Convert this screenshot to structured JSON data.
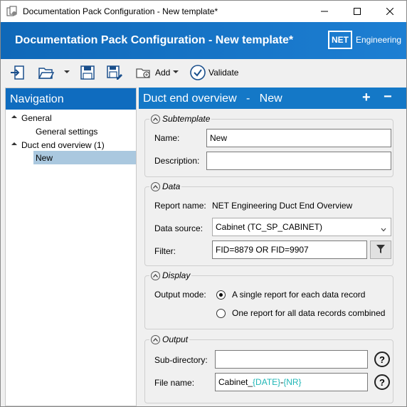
{
  "window": {
    "title": "Documentation Pack Configuration - New template*"
  },
  "header": {
    "title": "Documentation Pack Configuration - New template*",
    "logo_box": "NET",
    "logo_text": "Engineering"
  },
  "toolbar": {
    "add_label": "Add",
    "validate_label": "Validate"
  },
  "navigation": {
    "title": "Navigation",
    "items": [
      {
        "label": "General"
      },
      {
        "label": "General settings"
      },
      {
        "label": "Duct end overview (1)"
      },
      {
        "label": "New"
      }
    ]
  },
  "main": {
    "title": "Duct end overview",
    "separator": "-",
    "subtitle": "New",
    "plus": "+",
    "minus": "−"
  },
  "subtemplate": {
    "legend": "Subtemplate",
    "name_label": "Name:",
    "name_value": "New",
    "description_label": "Description:",
    "description_value": ""
  },
  "data_section": {
    "legend": "Data",
    "report_name_label": "Report name:",
    "report_name_value": "NET Engineering Duct End Overview",
    "data_source_label": "Data source:",
    "data_source_value": "Cabinet (TC_SP_CABINET)",
    "filter_label": "Filter:",
    "filter_value": "FID=8879 OR FID=9907"
  },
  "display": {
    "legend": "Display",
    "output_mode_label": "Output mode:",
    "option_single": "A single report for each data record",
    "option_combined": "One report for all data records combined",
    "selected": "single"
  },
  "output": {
    "legend": "Output",
    "subdirectory_label": "Sub-directory:",
    "subdirectory_value": "",
    "file_name_label": "File name:",
    "file_name_prefix": "Cabinet_",
    "file_name_tag1": "{DATE}",
    "file_name_sep": "-",
    "file_name_tag2": "{NR}",
    "help": "?"
  },
  "colors": {
    "header_blue": "#0f68b8",
    "panel_header_blue": "#1478c7",
    "selection": "#aac8df",
    "tag_color": "#1fb6b6"
  },
  "icons": [
    "import-icon",
    "open-folder-icon",
    "save-icon",
    "save-as-icon",
    "add-folder-icon",
    "validate-check-icon",
    "filter-funnel-icon",
    "help-icon"
  ]
}
